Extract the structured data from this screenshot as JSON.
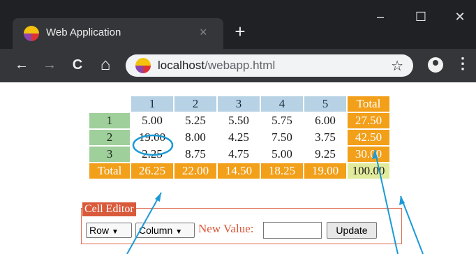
{
  "browser": {
    "tab_title": "Web Application",
    "tab_close_icon": "×",
    "new_tab_icon": "+",
    "window_controls": {
      "minimize": "–",
      "maximize": "☐",
      "close": "✕"
    },
    "nav": {
      "back": "←",
      "forward": "→",
      "reload": "C",
      "home": "⌂"
    },
    "url_host": "localhost",
    "url_path": "/webapp.html",
    "bookmark_icon": "☆",
    "menu_icon": "⋮"
  },
  "grid": {
    "column_headers": [
      "1",
      "2",
      "3",
      "4",
      "5"
    ],
    "total_label": "Total",
    "rows": [
      {
        "label": "1",
        "values": [
          "5.00",
          "5.25",
          "5.50",
          "5.75",
          "6.00"
        ],
        "total": "27.50"
      },
      {
        "label": "2",
        "values": [
          "19.00",
          "8.00",
          "4.25",
          "7.50",
          "3.75"
        ],
        "total": "42.50"
      },
      {
        "label": "3",
        "values": [
          "2.25",
          "8.75",
          "4.75",
          "5.00",
          "9.25"
        ],
        "total": "30.00"
      }
    ],
    "column_totals": [
      "26.25",
      "22.00",
      "14.50",
      "18.25",
      "19.00"
    ],
    "grand_total": "100.00"
  },
  "editor": {
    "legend": "Cell Editor",
    "row_select": "Row",
    "column_select": "Column",
    "new_value_label": "New Value:",
    "new_value": "",
    "update_button": "Update"
  },
  "colors": {
    "column_header": "#b6d2e4",
    "row_header": "#9fcf9a",
    "total": "#f29f1a",
    "grand_total": "#e2eb9c",
    "editor_accent": "#d9593b",
    "annotation": "#1b9ad6"
  }
}
